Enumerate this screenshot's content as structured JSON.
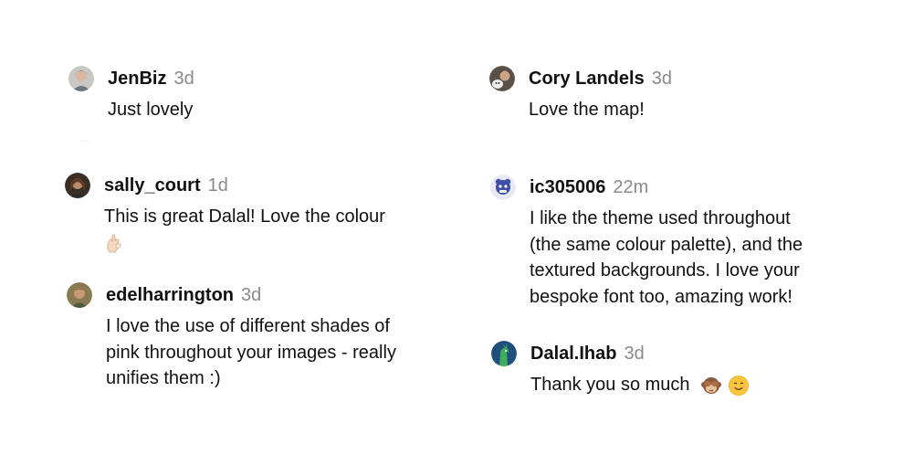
{
  "comments": [
    {
      "user": "JenBiz",
      "time": "3d",
      "lines": [
        "Just lovely"
      ]
    },
    {
      "user": "Cory Landels",
      "time": "3d",
      "lines": [
        "Love the map!"
      ]
    },
    {
      "user": "sally_court",
      "time": "1d",
      "lines": [
        "This is great Dalal! Love the colour"
      ],
      "emoji": [
        "ok-hand-emoji"
      ]
    },
    {
      "user": "ic305006",
      "time": "22m",
      "lines": [
        "I like the theme used throughout",
        "(the same colour palette), and the",
        "textured backgrounds. I love your",
        "bespoke font too, amazing work!"
      ]
    },
    {
      "user": "edelharrington",
      "time": "3d",
      "lines": [
        "I love the use of different shades of",
        "pink throughout your images - really",
        "unifies them :)"
      ]
    },
    {
      "user": "Dalal.Ihab",
      "time": "3d",
      "lines": [
        "Thank you so much"
      ],
      "emoji": [
        "see-no-evil-monkey-emoji",
        "smiling-face-emoji"
      ]
    }
  ],
  "colors": {
    "text": "#111111",
    "timestamp": "#8a8a8a",
    "background": "#ffffff"
  }
}
